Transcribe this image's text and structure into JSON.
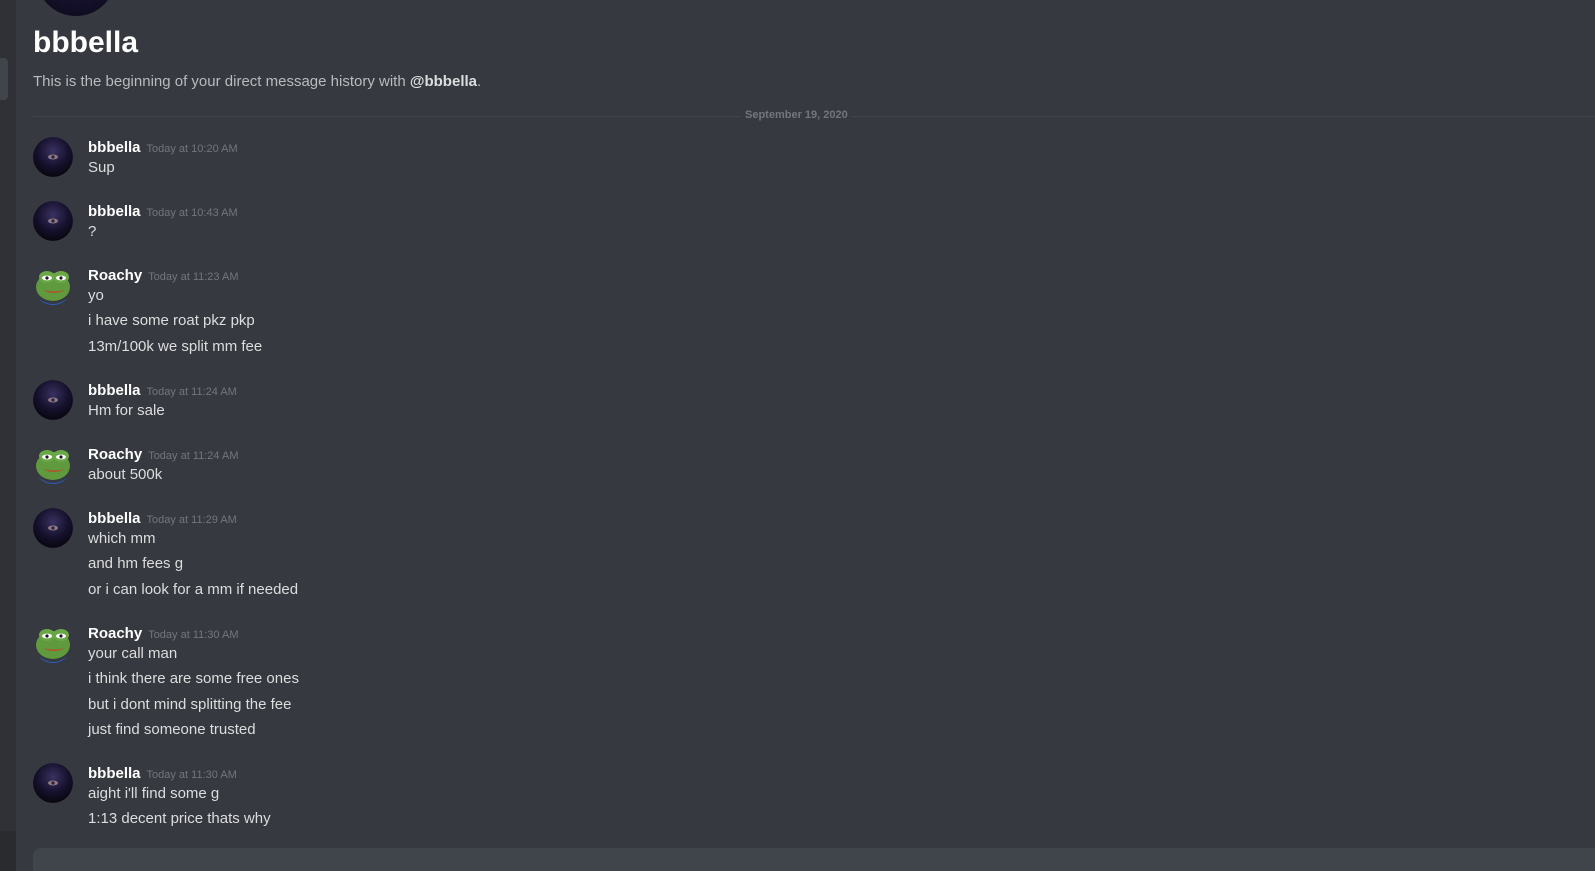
{
  "channel": {
    "title": "bbbella",
    "intro_prefix": "This is the beginning of your direct message history with ",
    "intro_mention": "@bbbella",
    "intro_suffix": "."
  },
  "date_divider": "September 19, 2020",
  "colors": {
    "background": "#36393f",
    "username": "#ffffff",
    "timestamp": "#72767d",
    "message_text": "#dcddde"
  },
  "groups": [
    {
      "author": "bbbella",
      "avatar": "dark-orb-avatar",
      "timestamp": "Today at 10:20 AM",
      "lines": [
        "Sup"
      ]
    },
    {
      "author": "bbbella",
      "avatar": "dark-orb-avatar",
      "timestamp": "Today at 10:43 AM",
      "lines": [
        "?"
      ]
    },
    {
      "author": "Roachy",
      "avatar": "frog-avatar",
      "timestamp": "Today at 11:23 AM",
      "lines": [
        "yo",
        "i have some roat pkz pkp",
        "13m/100k we split mm fee"
      ]
    },
    {
      "author": "bbbella",
      "avatar": "dark-orb-avatar",
      "timestamp": "Today at 11:24 AM",
      "lines": [
        "Hm for sale"
      ]
    },
    {
      "author": "Roachy",
      "avatar": "frog-avatar",
      "timestamp": "Today at 11:24 AM",
      "lines": [
        "about 500k"
      ]
    },
    {
      "author": "bbbella",
      "avatar": "dark-orb-avatar",
      "timestamp": "Today at 11:29 AM",
      "lines": [
        "which mm",
        "and hm fees g",
        "or i can look for a mm if needed"
      ]
    },
    {
      "author": "Roachy",
      "avatar": "frog-avatar",
      "timestamp": "Today at 11:30 AM",
      "lines": [
        "your call man",
        "i think there are some free ones",
        "but i dont mind splitting the fee",
        "just find someone trusted"
      ]
    },
    {
      "author": "bbbella",
      "avatar": "dark-orb-avatar",
      "timestamp": "Today at 11:30 AM",
      "lines": [
        "aight i'll find some g",
        "1:13 decent price thats why"
      ]
    }
  ]
}
